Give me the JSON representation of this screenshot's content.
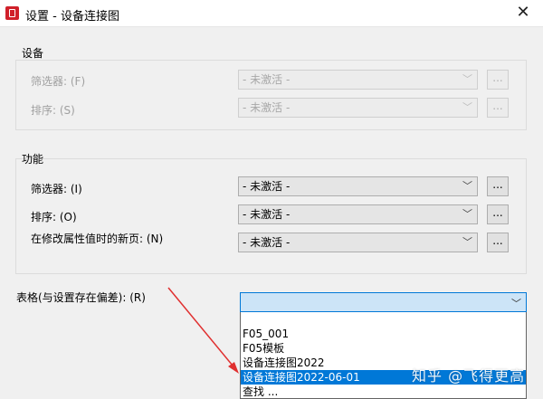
{
  "window": {
    "title": "设置 - 设备连接图",
    "close_glyph": "✕"
  },
  "device_group": {
    "title": "设备",
    "filter_label": "筛选器: (F)",
    "filter_value": "- 未激活 -",
    "sort_label": "排序: (S)",
    "sort_value": "- 未激活 -",
    "dots": "..."
  },
  "function_group": {
    "title": "功能",
    "filter_label": "筛选器: (I)",
    "filter_value": "- 未激活 -",
    "sort_label": "排序: (O)",
    "sort_value": "- 未激活 -",
    "newpage_label": "在修改属性值时的新页: (N)",
    "newpage_value": "- 未激活 -",
    "dots": "..."
  },
  "table": {
    "label": "表格(与设置存在偏差): (R)",
    "value": "",
    "options": [
      "F05_001",
      "F05模板",
      "设备连接图2022",
      "设备连接图2022-06-01",
      "查找 ..."
    ],
    "selected_index": 3
  },
  "icons": {
    "chevron": "chevron-down-icon",
    "app": "app-icon",
    "close": "close-icon"
  },
  "watermark": "知乎 @飞得更高",
  "colors": {
    "accent": "#0078d7",
    "annotation_arrow": "#e03030",
    "app_icon": "#d0202a"
  }
}
